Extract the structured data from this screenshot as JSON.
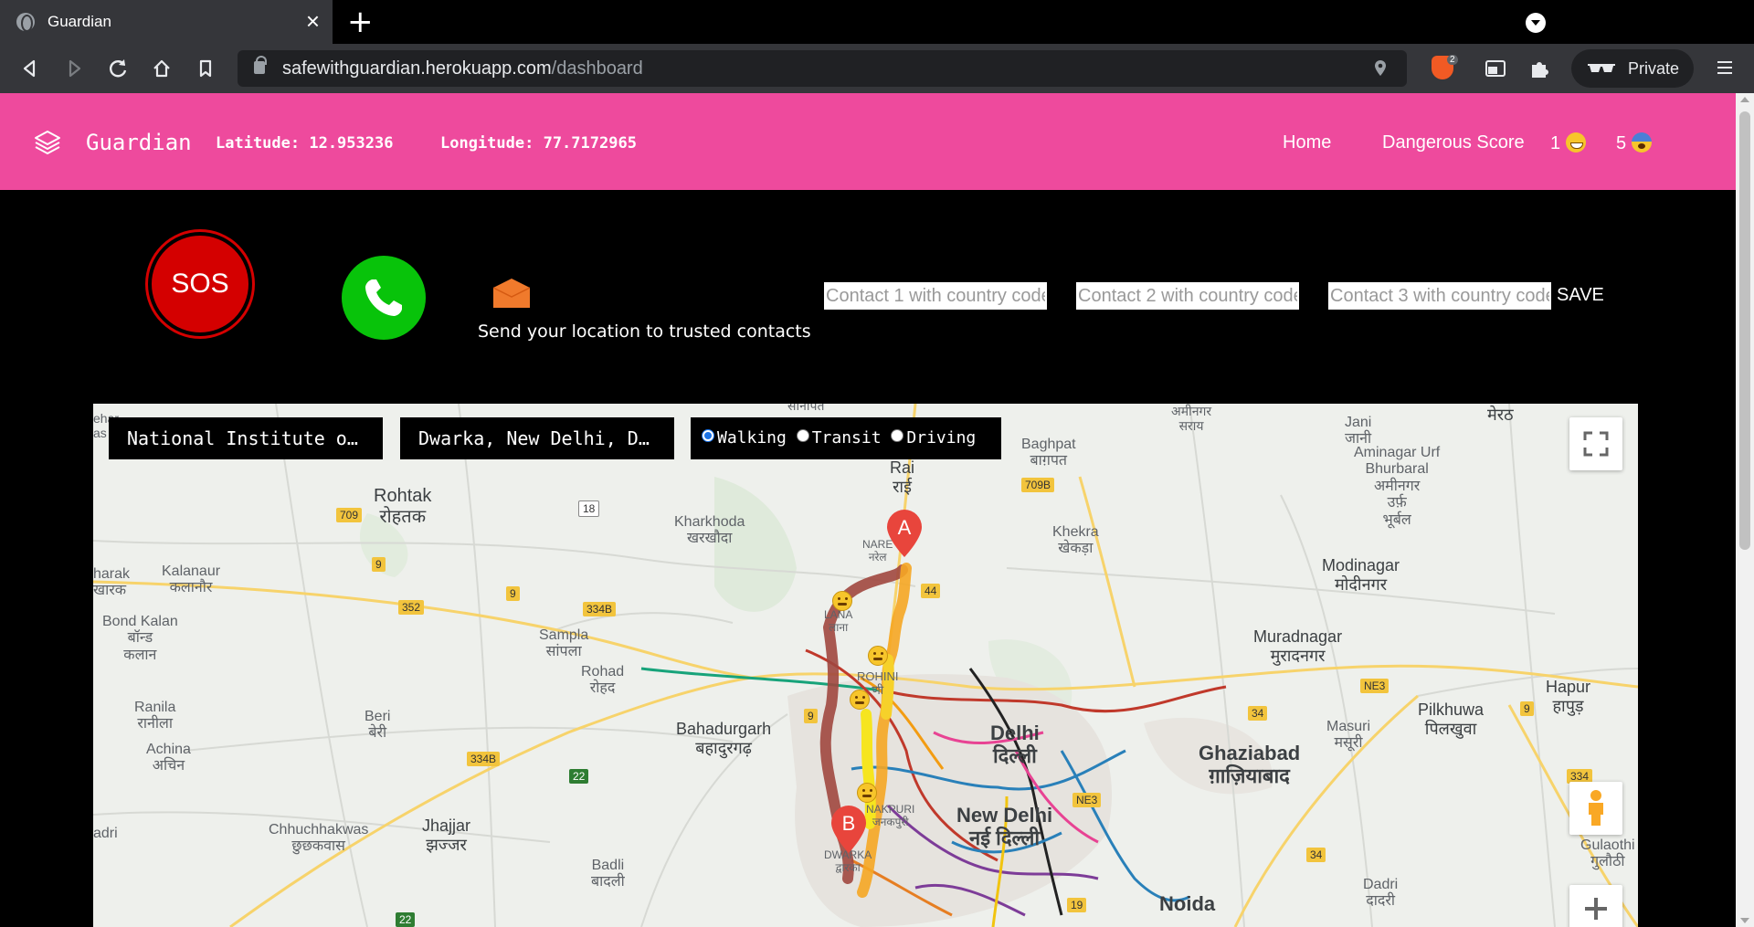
{
  "browser": {
    "tab_title": "Guardian",
    "url_host": "safewithguardian.herokuapp.com",
    "url_path": "/dashboard",
    "private_label": "Private",
    "shields_count": "2"
  },
  "navbar": {
    "brand": "Guardian",
    "latitude_text": "Latitude: 12.953236",
    "longitude_text": "Longitude: 77.7172965",
    "home_label": "Home",
    "dangerous_label": "Dangerous Score",
    "score_happy": "1",
    "score_fear": "5",
    "accent_color": "#ee4a9d"
  },
  "actions": {
    "sos_label": "SOS",
    "send_label": "Send your location to trusted contacts",
    "contact1_placeholder": "Contact 1 with country code",
    "contact2_placeholder": "Contact 2 with country code",
    "contact3_placeholder": "Contact 3 with country code",
    "save_label": "SAVE"
  },
  "map": {
    "origin": "National Institute o…",
    "destination": "Dwarka, New Delhi, D…",
    "modes": [
      {
        "label": "Walking",
        "selected": true
      },
      {
        "label": "Transit",
        "selected": false
      },
      {
        "label": "Driving",
        "selected": false
      }
    ],
    "marker_a": "A",
    "marker_b": "B",
    "places": {
      "rohtak": "Rohtak\nरोहतक",
      "kharkhoda": "Kharkhoda\nखरखौदा",
      "kalanaur": "Kalanaur\nकलानौर",
      "kharak": "harak\nखारक",
      "bond_kalan": "Bond Kalan\nबॉन्ड\nकलान",
      "sampla": "Sampla\nसांपला",
      "rohad": "Rohad\nरोहद",
      "ranila": "Ranila\nरानीला",
      "beri": "Beri\nबेरी",
      "achina": "Achina\nअचिन",
      "bahadurgarh": "Bahadurgarh\nबहादुरगढ़",
      "delhi": "Delhi\nदिल्ली",
      "new_delhi": "New Delhi\nनई दिल्ली",
      "ghaziabad": "Ghaziabad\nग़ाज़ियाबाद",
      "noida": "Noida",
      "baghpat": "Baghpat\nबाग़पत",
      "rai": "Rai\nराई",
      "khekra": "Khekra\nखेकड़ा",
      "modinagar": "Modinagar\nमोदीनगर",
      "muradnagar": "Muradnagar\nमुरादनगर",
      "aminagar": "Aminagar Urf\nBhurbaral\nअमीनगर\nउर्फ़\nभूर्बल",
      "jani": "Jani\nजानी",
      "meerut": "मेरठ",
      "amingar_sarai": "अमीनगर\nसराय",
      "hapur": "Hapur\nहापुड़",
      "pilkhuwa": "Pilkhuwa\nपिलखुवा",
      "masuri": "Masuri\nमसूरी",
      "gulaothi": "Gulaothi\nगुलौठी",
      "dadri": "Dadri\nदादरी",
      "jhajjar": "Jhajjar\nझज्जर",
      "chhuchhakwas": "Chhuchhakwas\nछुछकवास",
      "badli": "Badli\nबादली",
      "adri": "adri",
      "narela": "NARE\nनरेल",
      "alipur": "LANA\nलाना",
      "rohini": "ROHINI\nणी",
      "janakpuri": "NAKPURI\nजनकपुरी",
      "dwarka": "DWARKA\nद्वारका",
      "sonipat_top": "सोनीपत",
      "ehar": "ehar\nas"
    },
    "shields": [
      "709",
      "18",
      "9",
      "352",
      "9",
      "334B",
      "334B",
      "22",
      "709B",
      "44",
      "9",
      "NE3",
      "34",
      "9",
      "NE3",
      "34",
      "334",
      "19",
      "22"
    ]
  }
}
